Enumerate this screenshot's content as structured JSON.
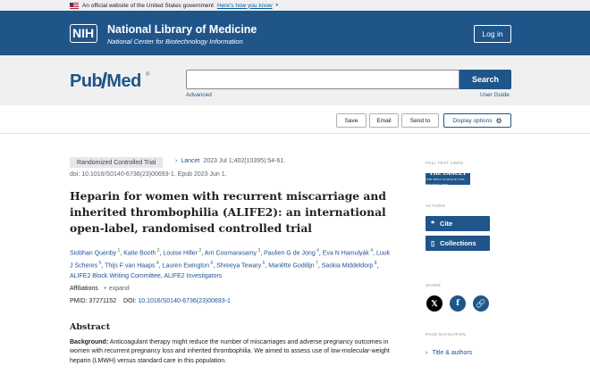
{
  "gov_banner": {
    "text": "An official website of the United States government",
    "link": "Here's how you know"
  },
  "header": {
    "logo": "NIH",
    "title": "National Library of Medicine",
    "subtitle": "National Center for Biotechnology Information",
    "login_label": "Log in",
    "brand_color": "#20558a"
  },
  "search": {
    "logo_pub": "Pub",
    "logo_med": "Med",
    "logo_mark": "®",
    "query": "",
    "placeholder": "",
    "button": "Search",
    "advanced": "Advanced",
    "user_guide": "User Guide"
  },
  "toolbar": {
    "save": "Save",
    "email": "Email",
    "send_to": "Send to",
    "display_options": "Display options",
    "display_icon": "gear-icon"
  },
  "article": {
    "type_badge": "Randomized Controlled Trial",
    "journal": "Lancet",
    "citation": "2023 Jul 1;402(10395):54-61.",
    "doi_line": "doi: 10.1016/S0140-6736(23)00693-1. Epub 2023 Jun 1.",
    "title": "Heparin for women with recurrent miscarriage and inherited thrombophilia (ALIFE2): an international open-label, randomised controlled trial",
    "authors": [
      {
        "name": "Siobhan Quenby",
        "sup": "1"
      },
      {
        "name": "Katie Booth",
        "sup": "2"
      },
      {
        "name": "Louise Hiller",
        "sup": "2"
      },
      {
        "name": "Arri Coomarasamy",
        "sup": "3"
      },
      {
        "name": "Paulien G de Jong",
        "sup": "4"
      },
      {
        "name": "Eva N Hamulyák",
        "sup": "4"
      },
      {
        "name": "Luuk J Scheres",
        "sup": "5"
      },
      {
        "name": "Thijs F van Haaps",
        "sup": "4"
      },
      {
        "name": "Lauren Ewington",
        "sup": "6"
      },
      {
        "name": "Shreeya Tewary",
        "sup": "6"
      },
      {
        "name": "Mariëtte Goddijn",
        "sup": "7"
      },
      {
        "name": "Saskia Middeldorp",
        "sup": "8"
      },
      {
        "name": "ALIFE2 Block Writing Committee",
        "sup": ""
      },
      {
        "name": "ALIFE2 Investigators",
        "sup": ""
      }
    ],
    "affiliations_label": "Affiliations",
    "expand_label": "+ expand",
    "pmid_label": "PMID:",
    "pmid": "37271152",
    "doi_label": "DOI:",
    "doi": "10.1016/S0140-6736(23)00693-1",
    "abstract_heading": "Abstract",
    "abstract_label": "Background:",
    "abstract_text": "Anticoagulant therapy might reduce the number of miscarriages and adverse pregnancy outcomes in women with recurrent pregnancy loss and inherited thrombophilia. We aimed to assess use of low-molecular-weight heparin (LMWH) versus standard care in this population."
  },
  "sidebar": {
    "full_text_label": "FULL TEXT LINKS",
    "lancet_logo": "THE LANCET",
    "lancet_sub": "THE BEST SCIENCE FOR BETTER LIVES",
    "actions_label": "ACTIONS",
    "cite": "Cite",
    "cite_icon": "quote-icon",
    "collections": "Collections",
    "collections_icon": "bookmark-icon",
    "share_label": "SHARE",
    "page_nav_label": "PAGE NAVIGATION",
    "nav_title_authors": "Title & authors"
  }
}
